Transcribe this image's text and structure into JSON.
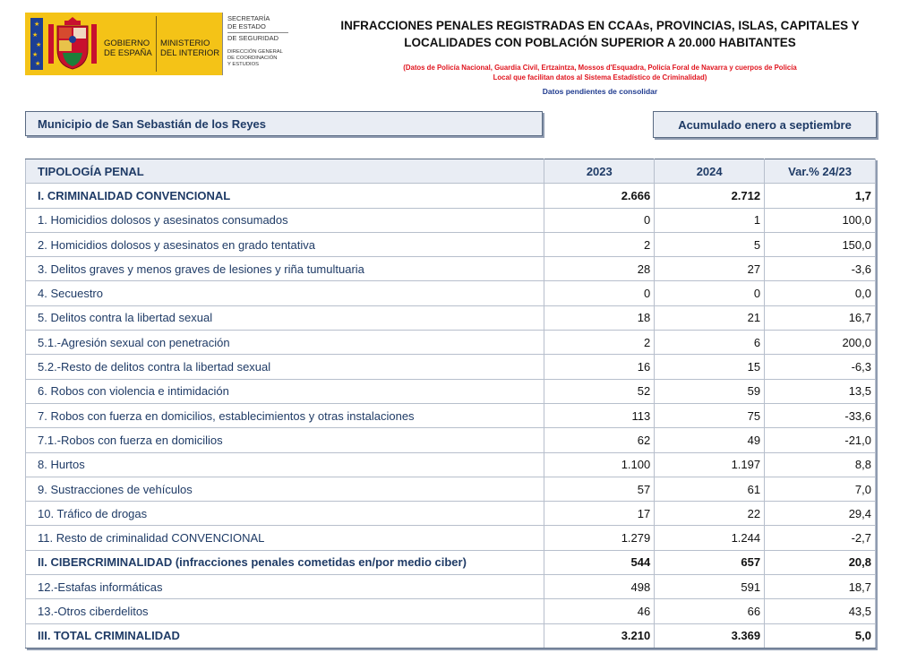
{
  "logo": {
    "gob_line1": "GOBIERNO",
    "gob_line2": "DE ESPAÑA",
    "min_line1": "MINISTERIO",
    "min_line2": "DEL INTERIOR",
    "sec_line1": "SECRETARÍA",
    "sec_line2": "DE ESTADO",
    "sec_line3": "DE SEGURIDAD",
    "dg_line1": "DIRECCIÓN GENERAL",
    "dg_line2": "DE COORDINACIÓN",
    "dg_line3": "Y ESTUDIOS",
    "colors": {
      "yellow": "#f4c317",
      "eu_blue": "#1d3f94",
      "crest_red": "#c8102e"
    }
  },
  "header": {
    "title_line1": "INFRACCIONES PENALES REGISTRADAS EN CCAAs, PROVINCIAS, ISLAS, CAPITALES Y",
    "title_line2": "LOCALIDADES CON POBLACIÓN SUPERIOR A 20.000 HABITANTES",
    "note_line1": "(Datos de Policía Nacional, Guardia Civil, Ertzaintza, Mossos d'Esquadra, Policía Foral de Navarra y cuerpos de Policía",
    "note_line2": "Local que facilitan datos al Sistema Estadístico de Criminalidad)",
    "pending": "Datos pendientes de consolidar"
  },
  "municipality": "Municipio de San Sebastián de los Reyes",
  "period": "Acumulado enero a septiembre",
  "table": {
    "headers": {
      "type": "TIPOLOGÍA PENAL",
      "y2023": "2023",
      "y2024": "2024",
      "var": "Var.% 24/23"
    },
    "rows": [
      {
        "label": "I. CRIMINALIDAD CONVENCIONAL",
        "y2023": "2.666",
        "y2024": "2.712",
        "var": "1,7",
        "section": true
      },
      {
        "label": "1. Homicidios dolosos y asesinatos consumados",
        "y2023": "0",
        "y2024": "1",
        "var": "100,0"
      },
      {
        "label": "2. Homicidios dolosos y asesinatos en grado tentativa",
        "y2023": "2",
        "y2024": "5",
        "var": "150,0"
      },
      {
        "label": "3. Delitos graves y menos graves de lesiones y riña tumultuaria",
        "y2023": "28",
        "y2024": "27",
        "var": "-3,6"
      },
      {
        "label": "4. Secuestro",
        "y2023": "0",
        "y2024": "0",
        "var": "0,0"
      },
      {
        "label": "5. Delitos contra la libertad sexual",
        "y2023": "18",
        "y2024": "21",
        "var": "16,7"
      },
      {
        "label": "5.1.-Agresión sexual con penetración",
        "y2023": "2",
        "y2024": "6",
        "var": "200,0"
      },
      {
        "label": "5.2.-Resto de delitos contra la libertad sexual",
        "y2023": "16",
        "y2024": "15",
        "var": "-6,3"
      },
      {
        "label": "6. Robos con violencia e intimidación",
        "y2023": "52",
        "y2024": "59",
        "var": "13,5"
      },
      {
        "label": "7. Robos con fuerza en domicilios, establecimientos y otras instalaciones",
        "y2023": "113",
        "y2024": "75",
        "var": "-33,6"
      },
      {
        "label": "7.1.-Robos con fuerza en domicilios",
        "y2023": "62",
        "y2024": "49",
        "var": "-21,0"
      },
      {
        "label": "8. Hurtos",
        "y2023": "1.100",
        "y2024": "1.197",
        "var": "8,8"
      },
      {
        "label": "9. Sustracciones de vehículos",
        "y2023": "57",
        "y2024": "61",
        "var": "7,0"
      },
      {
        "label": "10. Tráfico de drogas",
        "y2023": "17",
        "y2024": "22",
        "var": "29,4"
      },
      {
        "label": "11. Resto de criminalidad CONVENCIONAL",
        "y2023": "1.279",
        "y2024": "1.244",
        "var": "-2,7"
      },
      {
        "label": "II. CIBERCRIMINALIDAD (infracciones penales cometidas en/por medio ciber)",
        "y2023": "544",
        "y2024": "657",
        "var": "20,8",
        "section": true
      },
      {
        "label": "12.-Estafas informáticas",
        "y2023": "498",
        "y2024": "591",
        "var": "18,7"
      },
      {
        "label": "13.-Otros ciberdelitos",
        "y2023": "46",
        "y2024": "66",
        "var": "43,5"
      },
      {
        "label": "III. TOTAL CRIMINALIDAD",
        "y2023": "3.210",
        "y2024": "3.369",
        "var": "5,0",
        "section": true
      }
    ]
  }
}
